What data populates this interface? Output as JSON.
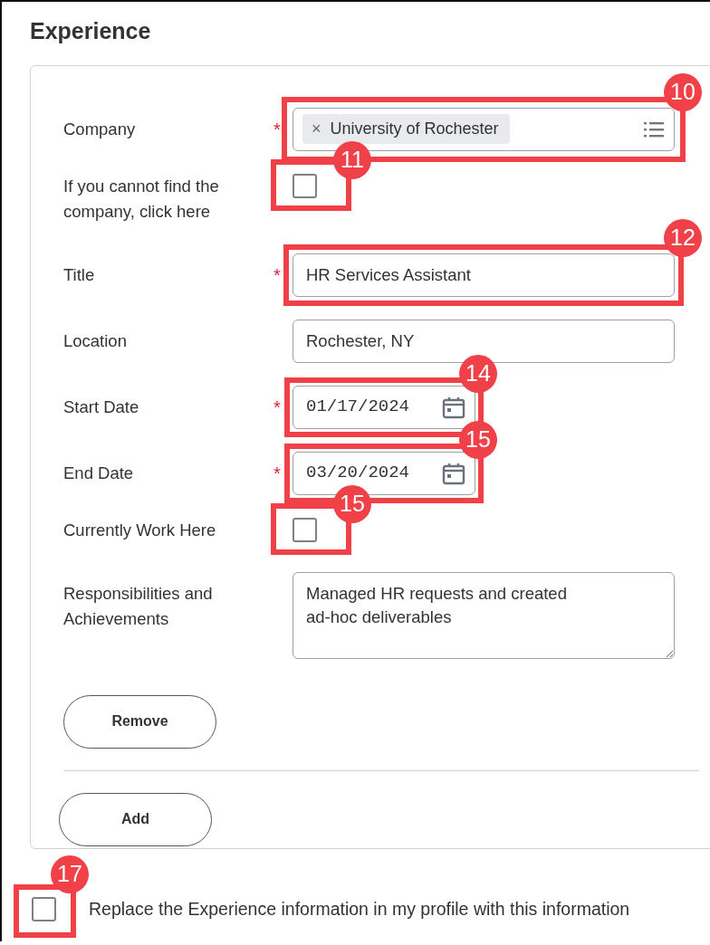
{
  "section_title": "Experience",
  "fields": [
    {
      "kind": "multiselect",
      "label": "Company",
      "required_mark": "*",
      "chip_remove": "×",
      "chip": "University of Rochester",
      "callout": "10"
    },
    {
      "kind": "checkbox",
      "label": "If you cannot find the company, click here",
      "checked": false,
      "callout": "11"
    },
    {
      "kind": "text",
      "label": "Title",
      "required_mark": "*",
      "value": "HR Services Assistant",
      "callout": "12"
    },
    {
      "kind": "text",
      "label": "Location",
      "value": "Rochester, NY"
    },
    {
      "kind": "date",
      "label": "Start Date",
      "required_mark": "*",
      "value": "01/17/2024",
      "callout": "14"
    },
    {
      "kind": "date",
      "label": "End Date",
      "required_mark": "*",
      "value": "03/20/2024",
      "callout": "15"
    },
    {
      "kind": "checkbox",
      "label": "Currently Work Here",
      "checked": false,
      "callout": "15"
    },
    {
      "kind": "textarea",
      "label": "Responsibilities and Achievements",
      "value": "Managed HR requests and created\nad-hoc deliverables"
    }
  ],
  "remove_button": "Remove",
  "add_button": "Add",
  "replace_option": {
    "label": "Replace the Experience information in my profile with this information",
    "checked": false,
    "callout": "17"
  }
}
